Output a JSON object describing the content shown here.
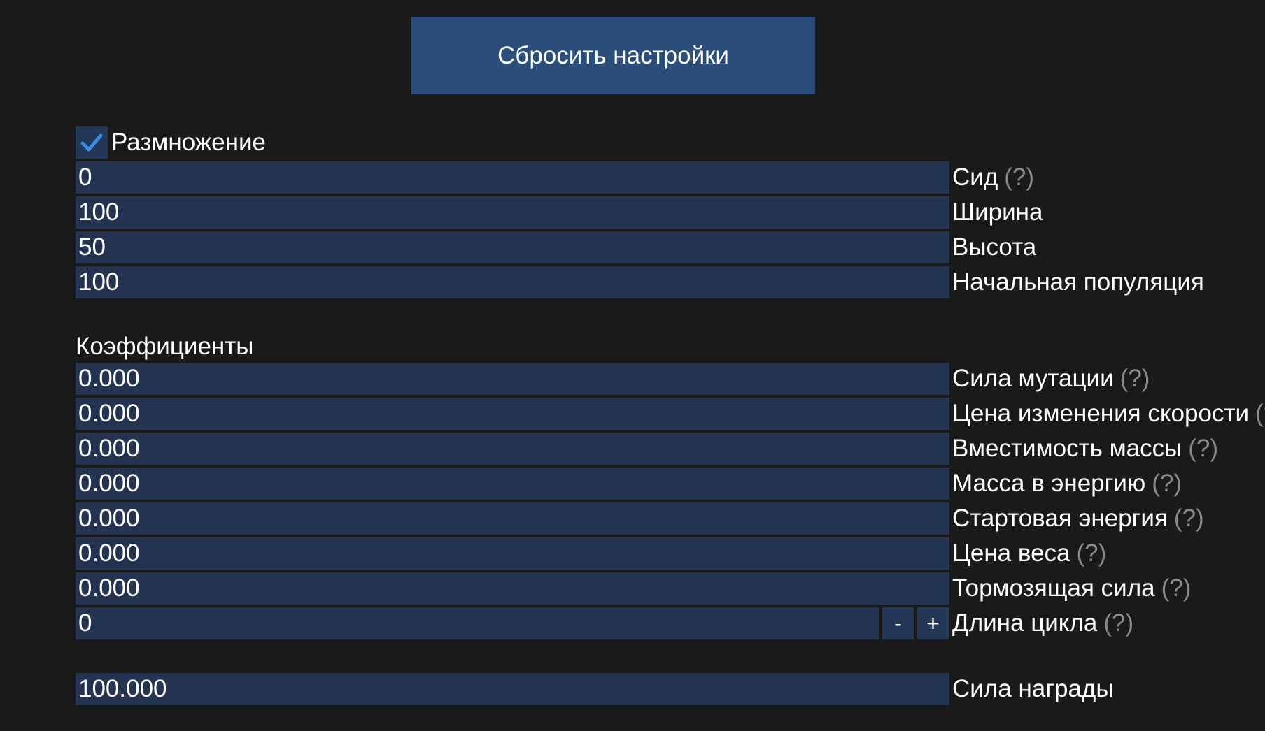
{
  "reset_button": {
    "label": "Сбросить настройки"
  },
  "reproduction": {
    "label": "Размножение",
    "checked": true
  },
  "help_mark": "(?)",
  "basic_fields": [
    {
      "value": "0",
      "label": "Сид",
      "help": "(?)"
    },
    {
      "value": "100",
      "label": "Ширина"
    },
    {
      "value": "50",
      "label": "Высота"
    },
    {
      "value": "100",
      "label": "Начальная популяция"
    }
  ],
  "coefficients": {
    "heading": "Коэффициенты",
    "fields": [
      {
        "value": "0.000",
        "label": "Сила мутации",
        "help": "(?)"
      },
      {
        "value": "0.000",
        "label": "Цена изменения скорости",
        "help": "(?)"
      },
      {
        "value": "0.000",
        "label": "Вместимость массы",
        "help": "(?)"
      },
      {
        "value": "0.000",
        "label": "Масса в энергию",
        "help": "(?)"
      },
      {
        "value": "0.000",
        "label": "Стартовая энергия",
        "help": "(?)"
      },
      {
        "value": "0.000",
        "label": "Цена веса",
        "help": "(?)"
      },
      {
        "value": "0.000",
        "label": "Тормозящая сила",
        "help": "(?)"
      }
    ],
    "cycle_length": {
      "value": "0",
      "label": "Длина цикла",
      "help": "(?)",
      "minus_label": "-",
      "plus_label": "+"
    }
  },
  "reward": {
    "value": "100.000",
    "label": "Сила награды"
  },
  "colors": {
    "background": "#1a1a1b",
    "field_bg": "#233350",
    "button_bg": "#2a4d7a",
    "checkmark": "#3a8ee6",
    "help_text": "#8a8a8a"
  }
}
